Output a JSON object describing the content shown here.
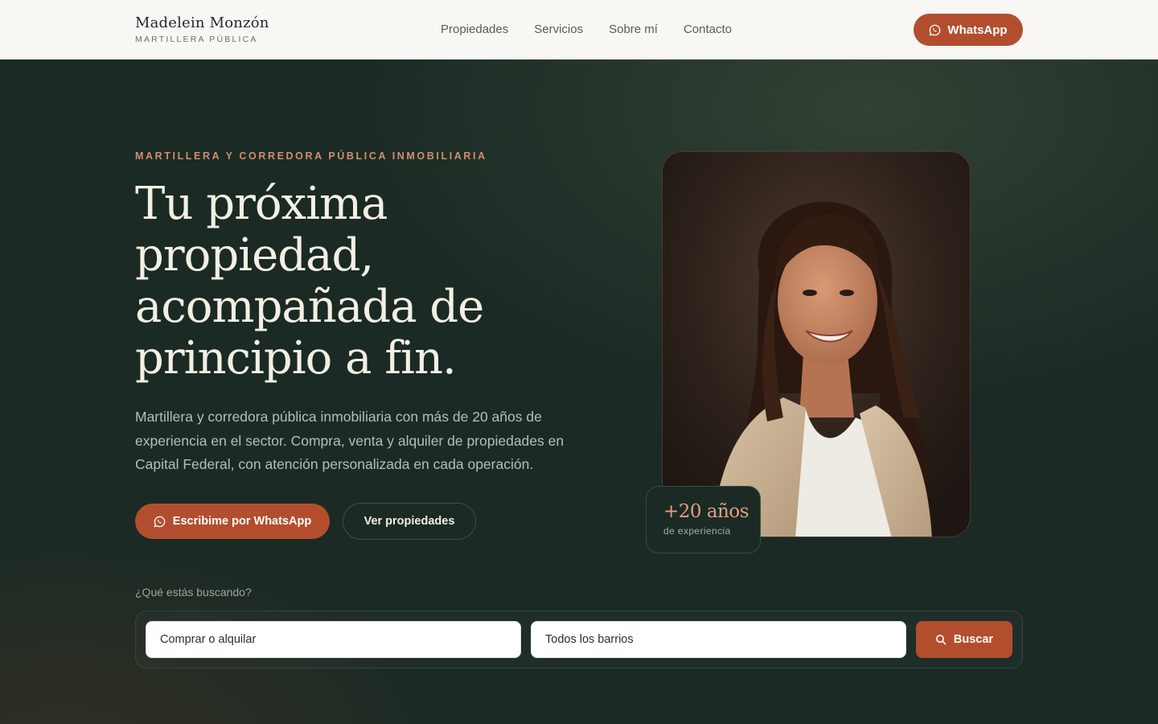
{
  "header": {
    "brand_name": "Madelein Monzón",
    "brand_sub": "MARTILLERA PÚBLICA",
    "nav": [
      {
        "label": "Propiedades"
      },
      {
        "label": "Servicios"
      },
      {
        "label": "Sobre mí"
      },
      {
        "label": "Contacto"
      }
    ],
    "cta_label": "WhatsApp"
  },
  "hero": {
    "eyebrow": "MARTILLERA Y CORREDORA PÚBLICA INMOBILIARIA",
    "headline": "Tu próxima propiedad, acompañada de principio a fin.",
    "lead": "Martillera y corredora pública inmobiliaria con más de 20 años de experiencia en el sector. Compra, venta y alquiler de propiedades en Capital Federal, con atención personalizada en cada operación.",
    "primary_cta": "Escribime por WhatsApp",
    "secondary_cta": "Ver propiedades",
    "badge_value": "+20 años",
    "badge_caption": "de experiencia"
  },
  "search": {
    "label": "¿Qué estás buscando?",
    "operation_value": "Comprar o alquilar",
    "neighborhood_value": "Todos los barrios",
    "button_label": "Buscar"
  },
  "colors": {
    "accent": "#b24e2e",
    "hero_bg": "#1b2a24",
    "eyebrow": "#d38d6c",
    "header_bg": "#f8f7f3"
  },
  "icons": [
    "whatsapp-icon",
    "search-icon",
    "portrait-photo"
  ]
}
